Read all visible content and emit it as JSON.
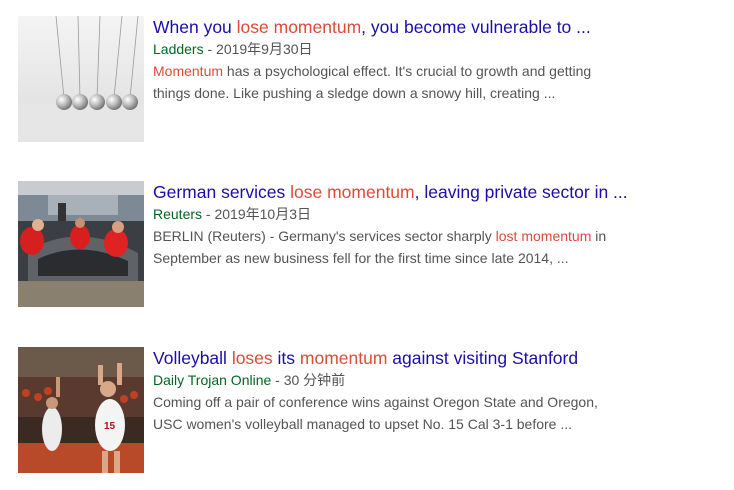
{
  "results": [
    {
      "title": [
        "When you ",
        "lose momentum",
        ", you become vulnerable to ..."
      ],
      "source": "Ladders",
      "date": " - 2019年9月30日",
      "snippet_line1": [
        "Momentum",
        " has a psychological effect. It's crucial to growth and getting"
      ],
      "snippet_line2": "things done. Like pushing a sledge down a snowy hill, creating ...",
      "thumbnail": "newtons-cradle"
    },
    {
      "title": [
        "German services ",
        "lose momentum",
        ", leaving private sector in ..."
      ],
      "source": "Reuters",
      "date": " - 2019年10月3日",
      "snippet_line1": [
        "BERLIN (Reuters) - Germany's services sector sharply ",
        "lost momentum",
        " in"
      ],
      "snippet_line2": "September as new business fell for the first time since late 2014, ...",
      "thumbnail": "car-factory-workers"
    },
    {
      "title": [
        "Volleyball ",
        "loses",
        " its ",
        "momentum",
        " against visiting Stanford"
      ],
      "source": "Daily Trojan Online",
      "date": " - 30 分钟前",
      "snippet_line1": [
        "Coming off a pair of conference wins against Oregon State and Oregon,"
      ],
      "snippet_line2": "USC women's volleyball managed to upset No. 15 Cal 3-1 before ...",
      "thumbnail": "volleyball-players"
    }
  ],
  "colors": {
    "title": "#1a0dab",
    "highlight": "#dd4b39",
    "source": "#006621",
    "text": "#545454"
  }
}
